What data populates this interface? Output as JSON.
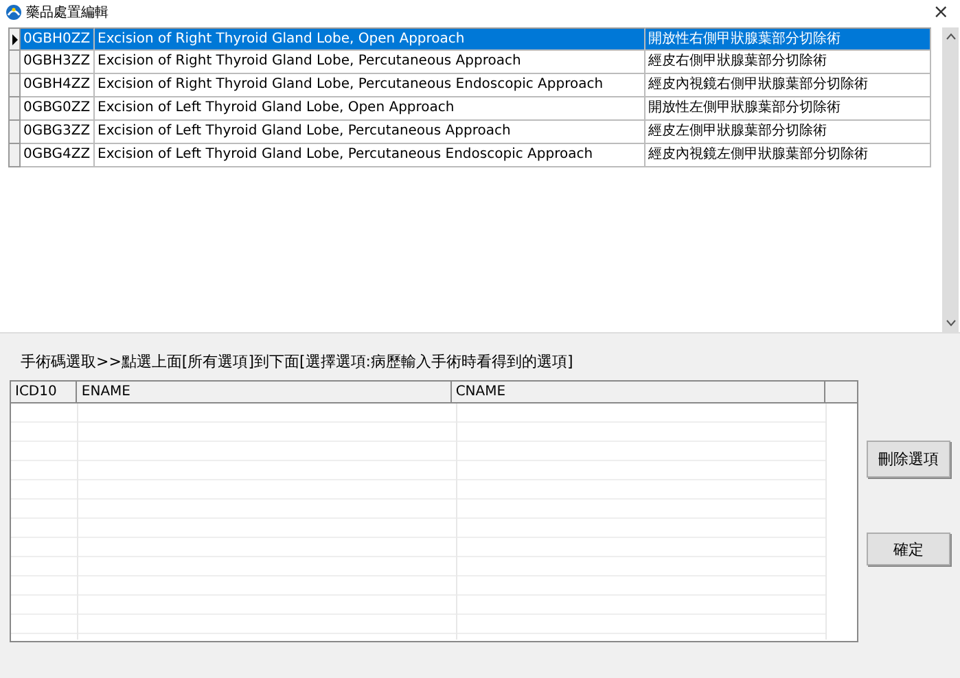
{
  "window": {
    "title": "藥品處置編輯",
    "close": "×"
  },
  "top_table": {
    "rows": [
      {
        "code": "0GBH0ZZ",
        "ename": "Excision of Right Thyroid Gland Lobe, Open Approach",
        "cname": "開放性右側甲狀腺葉部分切除術",
        "selected": true
      },
      {
        "code": "0GBH3ZZ",
        "ename": "Excision of Right Thyroid Gland Lobe, Percutaneous Approach",
        "cname": "經皮右側甲狀腺葉部分切除術",
        "selected": false
      },
      {
        "code": "0GBH4ZZ",
        "ename": "Excision of Right Thyroid Gland Lobe, Percutaneous Endoscopic Approach",
        "cname": "經皮內視鏡右側甲狀腺葉部分切除術",
        "selected": false
      },
      {
        "code": "0GBG0ZZ",
        "ename": "Excision of Left Thyroid Gland Lobe, Open Approach",
        "cname": "開放性左側甲狀腺葉部分切除術",
        "selected": false
      },
      {
        "code": "0GBG3ZZ",
        "ename": "Excision of Left Thyroid Gland Lobe, Percutaneous Approach",
        "cname": "經皮左側甲狀腺葉部分切除術",
        "selected": false
      },
      {
        "code": "0GBG4ZZ",
        "ename": "Excision of Left Thyroid Gland Lobe, Percutaneous Endoscopic Approach",
        "cname": "經皮內視鏡左側甲狀腺葉部分切除術",
        "selected": false
      }
    ]
  },
  "instruction": "手術碼選取>>點選上面[所有選項]到下面[選擇選項:病歷輸入手術時看得到的選項]",
  "bottom_table": {
    "columns": [
      "ICD10",
      "ENAME",
      "CNAME"
    ]
  },
  "buttons": [
    "刪除選項",
    "確定"
  ]
}
